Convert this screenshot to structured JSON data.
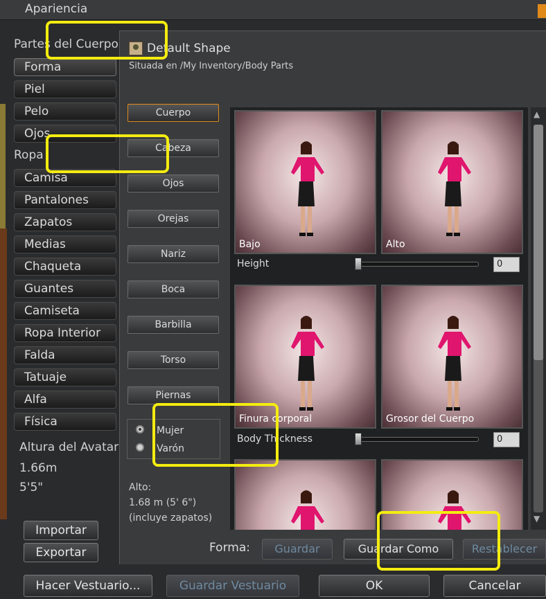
{
  "window": {
    "title": "Apariencia"
  },
  "left": {
    "body_parts_heading": "Partes del Cuerpo",
    "body_parts": [
      "Forma",
      "Piel",
      "Pelo",
      "Ojos"
    ],
    "clothing_heading": "Ropa",
    "clothing": [
      "Camisa",
      "Pantalones",
      "Zapatos",
      "Medias",
      "Chaqueta",
      "Guantes",
      "Camiseta",
      "Ropa Interior",
      "Falda",
      "Tatuaje",
      "Alfa",
      "Física"
    ],
    "avatar_height_label": "Altura del Avatar:",
    "avatar_height_m": "1.66m",
    "avatar_height_ft": "5'5\"",
    "import_btn": "Importar",
    "export_btn": "Exportar"
  },
  "editor": {
    "shape_name": "Default Shape",
    "location": "Situada en /My Inventory/Body Parts",
    "categories": [
      "Cuerpo",
      "Cabeza",
      "Ojos",
      "Orejas",
      "Nariz",
      "Boca",
      "Barbilla",
      "Torso",
      "Piernas"
    ],
    "gender": {
      "female": "Mujer",
      "male": "Varón",
      "selected": "female"
    },
    "height_label": "Alto:",
    "height_value": "1.68 m (5' 6\")",
    "height_note": "(incluye zapatos)",
    "sliders": [
      {
        "low_label": "Bajo",
        "high_label": "Alto",
        "name": "Height",
        "value": "0"
      },
      {
        "low_label": "Finura corporal",
        "high_label": "Grosor del Cuerpo",
        "name": "Body Thickness",
        "value": "0"
      }
    ],
    "bottom_label": "Forma:",
    "save_btn": "Guardar",
    "save_as_btn": "Guardar Como",
    "revert_btn": "Restablecer"
  },
  "footer": {
    "make_outfit_btn": "Hacer Vestuario...",
    "save_outfit_btn": "Guardar Vestuario",
    "ok_btn": "OK",
    "cancel_btn": "Cancelar"
  },
  "colors": {
    "highlight": "#f4ec10",
    "accent": "#e08a1a",
    "shirt": "#e0156e"
  }
}
